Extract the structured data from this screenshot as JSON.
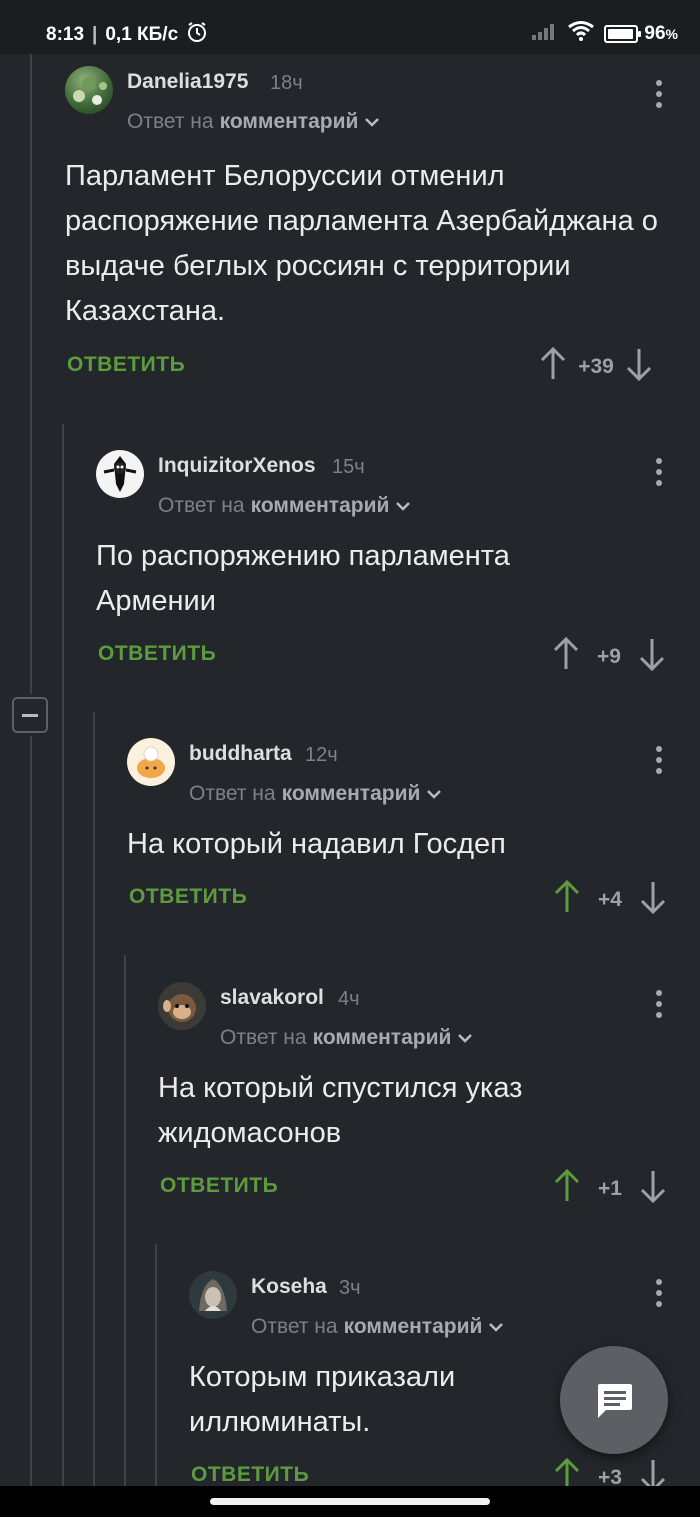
{
  "status_bar": {
    "time": "8:13",
    "network_speed": "0,1 КБ/с",
    "battery_percent": "96",
    "battery_level": 0.96
  },
  "reply_prefix": "Ответ на",
  "reply_target": "комментарий",
  "reply_button_label": "ОТВЕТИТЬ",
  "colors": {
    "accent_green": "#5c9b3e",
    "background": "#23272b"
  },
  "comments": [
    {
      "author": "Danelia1975",
      "time": "18ч",
      "text": "Парламент Белоруссии отменил распоряжение парламента Азербайджана о выдаче беглых россиян с территории Казахстана.",
      "score": "+39",
      "upvoted": false
    },
    {
      "author": "InquizitorXenos",
      "time": "15ч",
      "text": "По распоряжению парламента Армении",
      "score": "+9",
      "upvoted": false
    },
    {
      "author": "buddharta",
      "time": "12ч",
      "text": "На который надавил Госдеп",
      "score": "+4",
      "upvoted": true
    },
    {
      "author": "slavakorol",
      "time": "4ч",
      "text": "На который спустился указ жидомасонов",
      "score": "+1",
      "upvoted": true
    },
    {
      "author": "Koseha",
      "time": "3ч",
      "text": "Которым приказали иллюминаты.",
      "score": "+3",
      "upvoted": true
    }
  ],
  "fab_icon": "comment-icon"
}
